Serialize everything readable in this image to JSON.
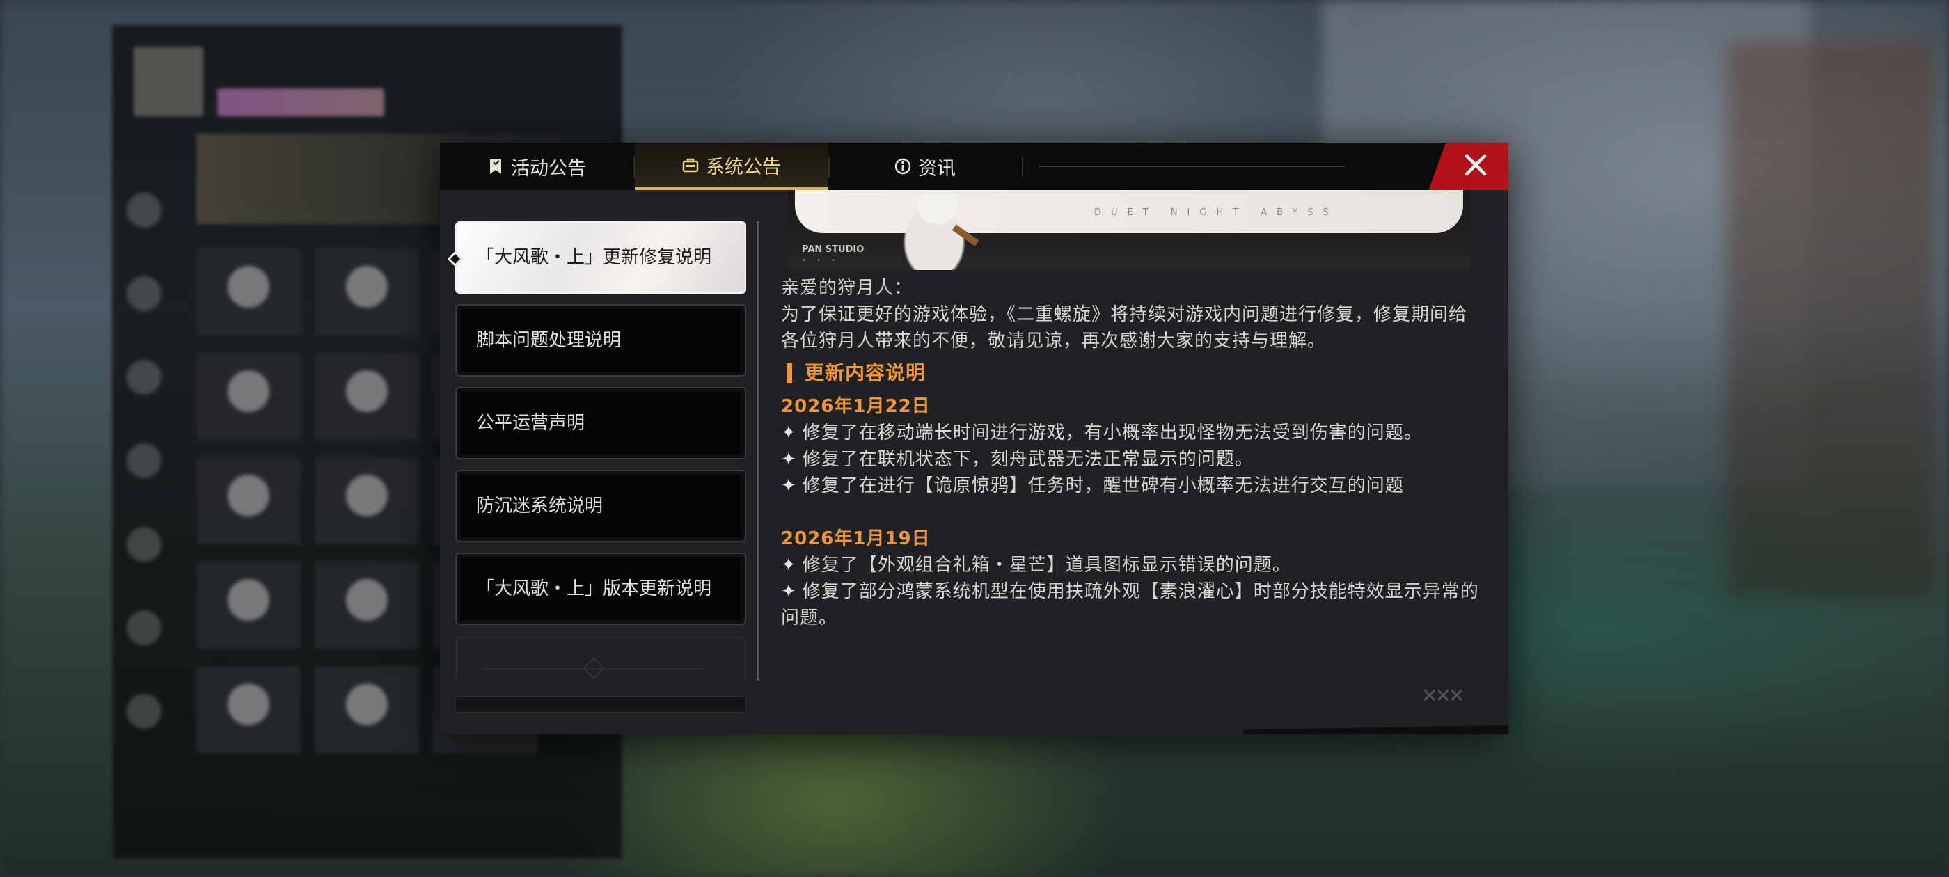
{
  "tabs": [
    {
      "label": "活动公告",
      "icon": "bookmark-icon",
      "active": false
    },
    {
      "label": "系统公告",
      "icon": "briefcase-icon",
      "active": true
    },
    {
      "label": "资讯",
      "icon": "info-icon",
      "active": false
    }
  ],
  "close_icon": "close-icon",
  "colors": {
    "accent_orange": "#f2953a",
    "active_tab_gold": "#d9b35a",
    "close_red": "#b3121a"
  },
  "announcements": [
    {
      "title": "「大风歌・上」更新修复说明",
      "active": true
    },
    {
      "title": "脚本问题处理说明",
      "active": false
    },
    {
      "title": "公平运营声明",
      "active": false
    },
    {
      "title": "防沉迷系统说明",
      "active": false
    },
    {
      "title": "「大风歌・上」版本更新说明",
      "active": false
    }
  ],
  "banner": {
    "studio": "PAN STUDIO",
    "subtitle": "DUET NIGHT ABYSS"
  },
  "article": {
    "greeting": "亲爱的狩月人：",
    "intro": "为了保证更好的游戏体验，《二重螺旋》将持续对游戏内问题进行修复，修复期间给各位狩月人带来的不便，敬请见谅，再次感谢大家的支持与理解。",
    "section_title": "更新内容说明",
    "sections": [
      {
        "date": "2026年1月22日",
        "items": [
          "修复了在移动端长时间进行游戏，有小概率出现怪物无法受到伤害的问题。",
          "修复了在联机状态下，刻舟武器无法正常显示的问题。",
          "修复了在进行【诡原惊鸦】任务时，醒世碑有小概率无法进行交互的问题"
        ]
      },
      {
        "date": "2026年1月19日",
        "items": [
          "修复了【外观组合礼箱・星芒】道具图标显示错误的问题。",
          "修复了部分鸿蒙系统机型在使用扶疏外观【素浪濯心】时部分技能特效显示异常的问题。"
        ]
      }
    ],
    "bullet_glyph": "✦"
  }
}
